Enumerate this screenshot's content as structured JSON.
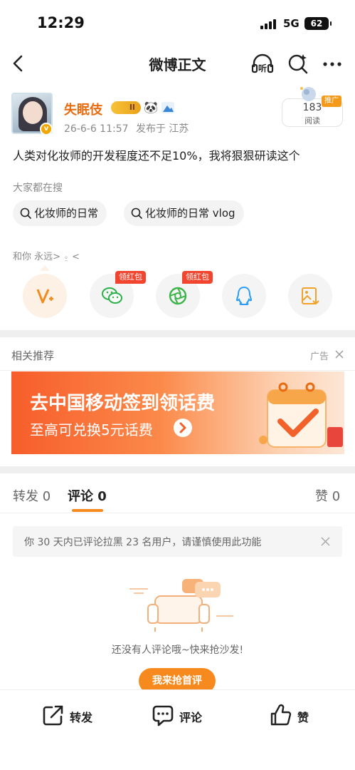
{
  "status_bar": {
    "time": "12:29",
    "network": "5G",
    "battery": "62"
  },
  "nav": {
    "title": "微博正文",
    "listen_label": "听"
  },
  "author": {
    "name": "失眠伎",
    "vip_level": "II",
    "post_time": "26-6-6 11:57",
    "location": "发布于 江苏",
    "reads_count": "183",
    "reads_label": "阅读",
    "promo_tag": "推广"
  },
  "post": {
    "text": "人类对化妆师的开发程度还不足10%，我将狠狠研读这个"
  },
  "search": {
    "title": "大家都在搜",
    "chips": [
      "化妆师的日常",
      "化妆师的日常 vlog"
    ]
  },
  "share": {
    "with_label": "和你 永远> ⍛ <",
    "red_tag": "领红包",
    "items": [
      "vplus-icon",
      "wechat-icon",
      "moments-icon",
      "qq-icon",
      "save-image-icon"
    ]
  },
  "related": {
    "title": "相关推荐",
    "ad_label": "广告"
  },
  "banner": {
    "title": "去中国移动签到领话费",
    "subtitle": "至高可兑换5元话费"
  },
  "tabs": {
    "repost": "转发 0",
    "comment": "评论 0",
    "like": "赞 0"
  },
  "notice": {
    "text": "你 30 天内已评论拉黑 23 名用户，请谨慎使用此功能"
  },
  "empty": {
    "text": "还没有人评论哦~快来抢沙发!",
    "button": "我来抢首评"
  },
  "bottom_bar": {
    "repost": "转发",
    "comment": "评论",
    "like": "赞"
  },
  "colors": {
    "accent": "#f78a1e",
    "name": "#e86b10",
    "red_tag": "#f2452f"
  }
}
